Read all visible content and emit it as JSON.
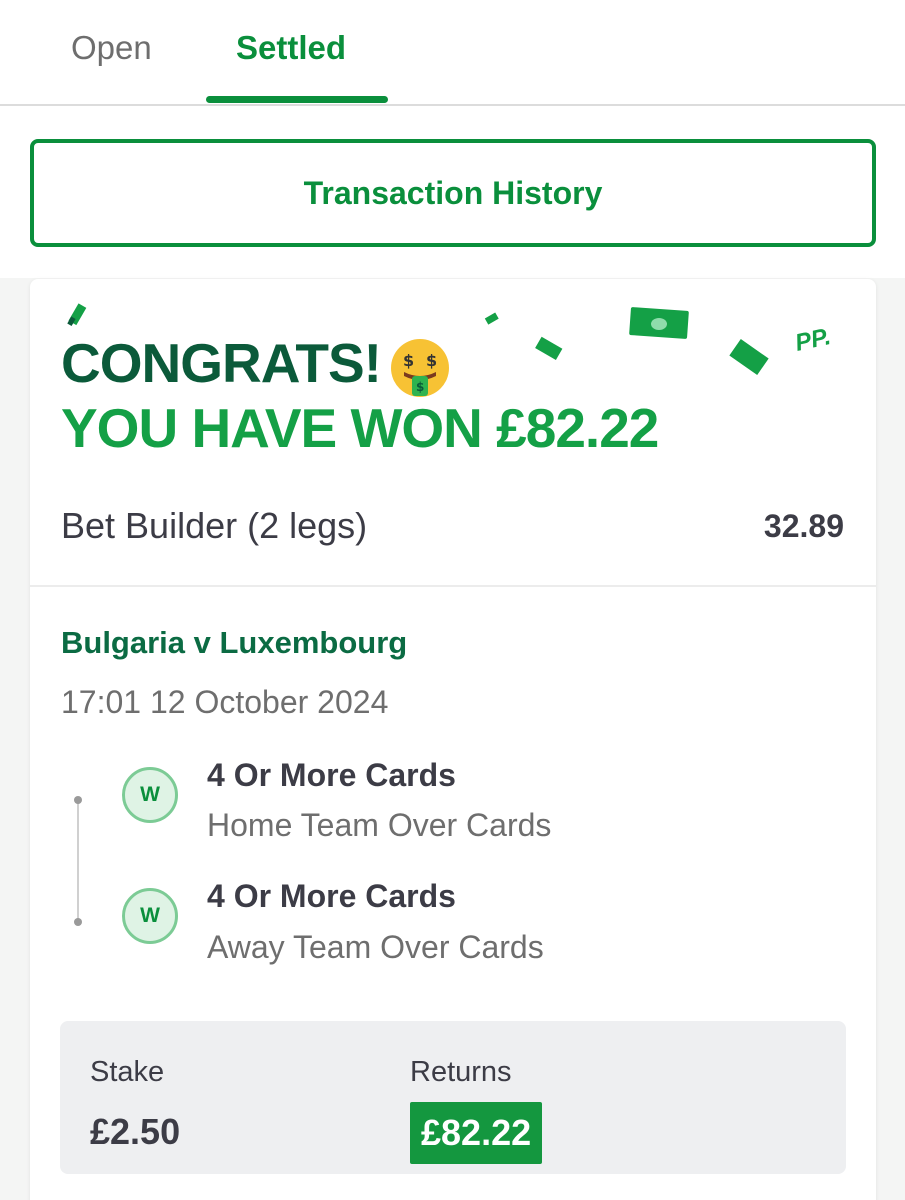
{
  "tabs": [
    {
      "label": "Open",
      "active": false
    },
    {
      "label": "Settled",
      "active": true
    }
  ],
  "transaction_button": {
    "label": "Transaction History"
  },
  "banner": {
    "line1": "CONGRATS!",
    "emoji": "money-mouth-face-icon",
    "line2": "YOU HAVE WON £82.22",
    "brand_mark": "PP."
  },
  "bet": {
    "title": "Bet Builder (2 legs)",
    "odds": "32.89",
    "event": "Bulgaria v Luxembourg",
    "datetime": "17:01 12 October 2024",
    "legs": [
      {
        "result": "W",
        "title": "4 Or More Cards",
        "subtitle": "Home Team Over Cards"
      },
      {
        "result": "W",
        "title": "4 Or More Cards",
        "subtitle": "Away Team Over Cards"
      }
    ],
    "stake_label": "Stake",
    "stake_value": "£2.50",
    "returns_label": "Returns",
    "returns_value": "£82.22"
  },
  "colors": {
    "brand_green": "#0a8f3c",
    "dark_green": "#0b5a3a",
    "bright_green": "#14a046"
  }
}
